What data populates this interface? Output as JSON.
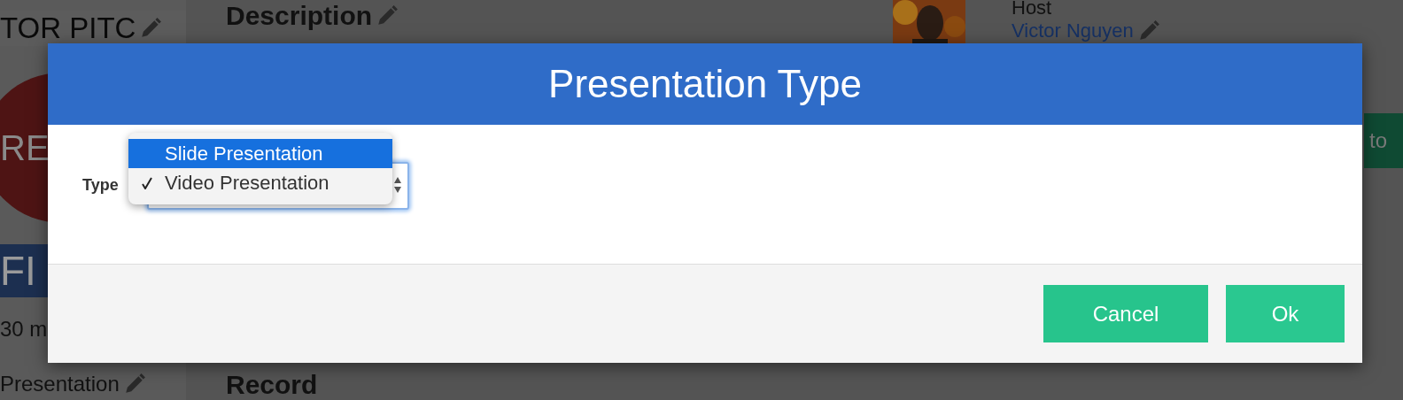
{
  "background": {
    "event_title": "TOR PITC",
    "record_badge": "RE",
    "banner": "FI",
    "duration": "30 m",
    "presentation_type": "Presentation",
    "description_heading": "Description",
    "record_heading": "Record",
    "host_label": "Host",
    "host_name": "Victor Nguyen",
    "side_button": "to"
  },
  "dialog": {
    "title": "Presentation Type",
    "field_label": "Type",
    "options": [
      {
        "label": "Slide Presentation",
        "selected": true,
        "checked": false
      },
      {
        "label": "Video Presentation",
        "selected": false,
        "checked": true
      }
    ],
    "buttons": [
      {
        "label": "Cancel",
        "kind": "cancel"
      },
      {
        "label": "Ok",
        "kind": "ok"
      }
    ]
  }
}
